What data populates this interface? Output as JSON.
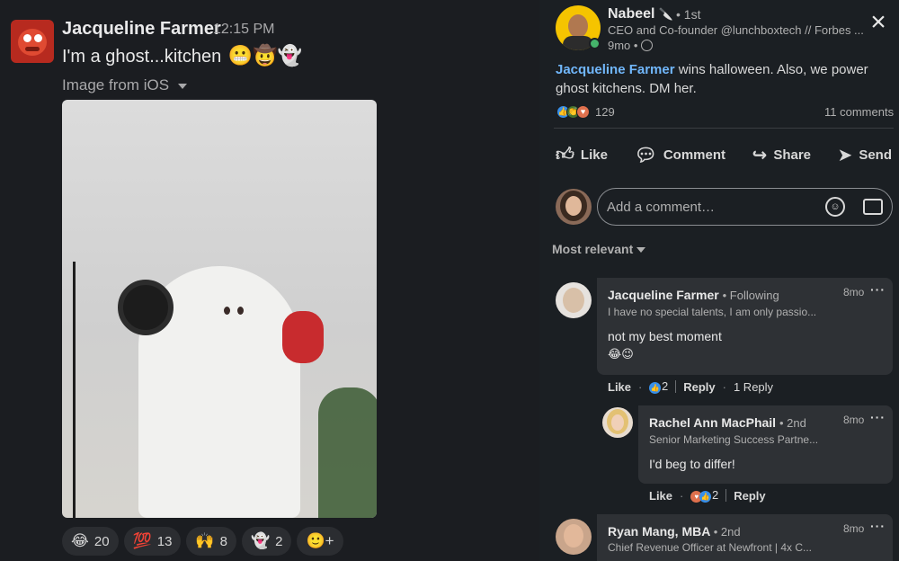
{
  "slack": {
    "sender": "Jacqueline Farmer",
    "time": "12:15 PM",
    "message": "I'm a ghost...kitchen",
    "message_emojis": "😬🤠👻",
    "image_label": "Image from iOS",
    "reactions": [
      {
        "emoji": "😂",
        "count": "20"
      },
      {
        "emoji": "💯",
        "count": "13"
      },
      {
        "emoji": "🙌",
        "count": "8"
      },
      {
        "emoji": "👻",
        "count": "2"
      }
    ],
    "add_reaction_icon": "🙂+"
  },
  "post": {
    "author": "Nabeel",
    "author_emoji": "🔪",
    "degree": "• 1st",
    "headline": "CEO and Co-founder @lunchboxtech // Forbes ...",
    "age": "9mo •",
    "mention": "Jacqueline Farmer",
    "text_rest": " wins halloween. Also, we power ghost kitchens. DM her.",
    "reaction_count": "129",
    "comments_count": "11 comments",
    "actions": {
      "like": "Like",
      "comment": "Comment",
      "share": "Share",
      "send": "Send"
    },
    "comment_placeholder": "Add a comment…",
    "sort_label": "Most relevant",
    "close_icon": "×"
  },
  "comments": [
    {
      "name": "Jacqueline Farmer",
      "relation": "• Following",
      "headline": "I have no special talents, I am only passio...",
      "time": "8mo",
      "text": "not my best moment",
      "emojis": "😂😉",
      "like": "Like",
      "reaction_count": "2",
      "reply": "Reply",
      "replies": "1 Reply"
    },
    {
      "name": "Rachel Ann MacPhail",
      "relation": "• 2nd",
      "headline": "Senior Marketing Success Partne...",
      "time": "8mo",
      "text": "I'd beg to differ!",
      "like": "Like",
      "reaction_count": "2",
      "reply": "Reply"
    },
    {
      "name": "Ryan Mang, MBA",
      "relation": "• 2nd",
      "headline": "Chief Revenue Officer at Newfront | 4x C...",
      "time": "8mo"
    }
  ],
  "colors": {
    "background": "#1b1f23",
    "link": "#71b7fb",
    "online": "#45b36b",
    "bubble": "#2e3135"
  }
}
